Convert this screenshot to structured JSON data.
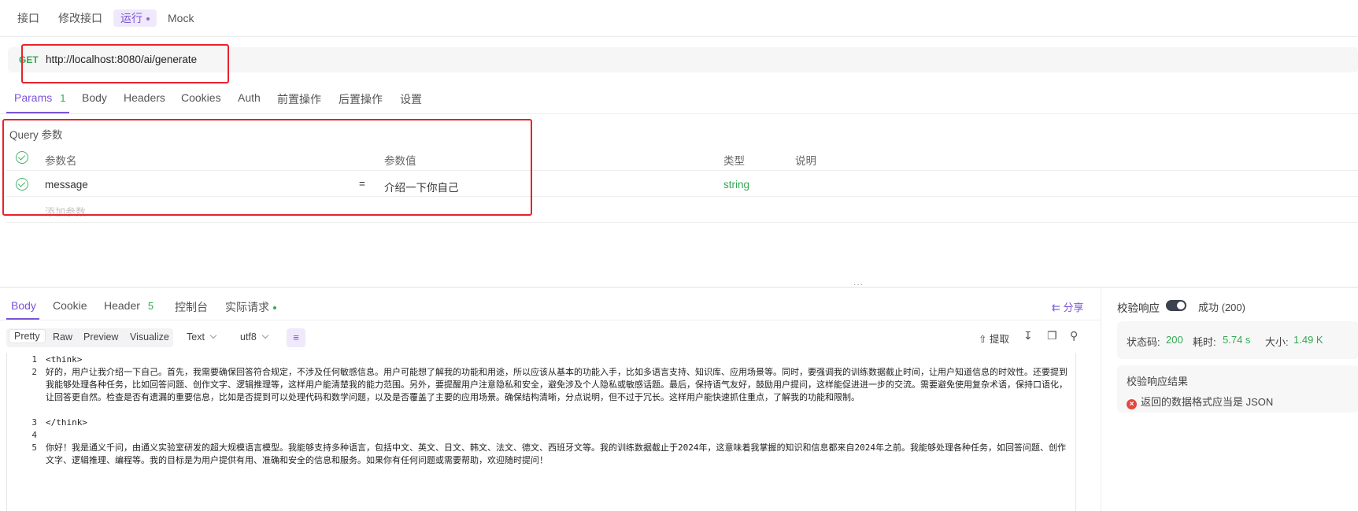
{
  "top_tabs": {
    "api": "接口",
    "edit": "修改接口",
    "run": "运行",
    "mock": "Mock"
  },
  "request": {
    "method": "GET",
    "url": "http://localhost:8080/ai/generate"
  },
  "request_tabs": {
    "params": "Params",
    "params_count": "1",
    "body": "Body",
    "headers": "Headers",
    "cookies": "Cookies",
    "auth": "Auth",
    "pre": "前置操作",
    "post": "后置操作",
    "settings": "设置"
  },
  "query": {
    "title": "Query 参数",
    "headers": {
      "name": "参数名",
      "value": "参数值",
      "type": "类型",
      "desc": "说明"
    },
    "rows": [
      {
        "name": "message",
        "eq": "=",
        "value": "介绍一下你自己",
        "type": "string"
      }
    ],
    "add_placeholder": "添加参数"
  },
  "response_tabs": {
    "body": "Body",
    "cookie": "Cookie",
    "header": "Header",
    "header_count": "5",
    "console": "控制台",
    "actual": "实际请求"
  },
  "share": "分享",
  "format_tabs": {
    "pretty": "Pretty",
    "raw": "Raw",
    "preview": "Preview",
    "visualize": "Visualize"
  },
  "content_type": "Text",
  "encoding": "utf8",
  "toolbar": {
    "extract": "提取"
  },
  "code_lines": [
    {
      "n": "1",
      "text": "<think>"
    },
    {
      "n": "2",
      "text": "好的，用户让我介绍一下自己。首先，我需要确保回答符合规定，不涉及任何敏感信息。用户可能想了解我的功能和用途，所以应该从基本的功能入手，比如多语言支持、知识库、应用场景等。同时，要强调我的训练数据截止时间，让用户知道信息的时效性。还要提到我能够处理各种任务，比如回答问题、创作文字、逻辑推理等，这样用户能清楚我的能力范围。另外，要提醒用户注意隐私和安全，避免涉及个人隐私或敏感话题。最后，保持语气友好，鼓励用户提问，这样能促进进一步的交流。需要避免使用复杂术语，保持口语化，让回答更自然。检查是否有遗漏的重要信息，比如是否提到可以处理代码和数学问题，以及是否覆盖了主要的应用场景。确保结构清晰，分点说明，但不过于冗长。这样用户能快速抓住重点，了解我的功能和限制。"
    },
    {
      "n": "3",
      "text": "</think>"
    },
    {
      "n": "4",
      "text": ""
    },
    {
      "n": "5",
      "text": "你好！我是通义千问，由通义实验室研发的超大规模语言模型。我能够支持多种语言，包括中文、英文、日文、韩文、法文、德文、西班牙文等。我的训练数据截止于2024年，这意味着我掌握的知识和信息都来自2024年之前。我能够处理各种任务，如回答问题、创作文字、逻辑推理、编程等。我的目标是为用户提供有用、准确和安全的信息和服务。如果你有任何问题或需要帮助，欢迎随时提问！"
    }
  ],
  "validation": {
    "label": "校验响应",
    "result": "成功 (200)",
    "status_label": "状态码:",
    "status_value": "200",
    "time_label": "耗时:",
    "time_value": "5.74 s",
    "size_label": "大小:",
    "size_value": "1.49 K",
    "result_title": "校验响应结果",
    "error_msg": "返回的数据格式应当是 JSON"
  },
  "colors": {
    "accent": "#7b55d6",
    "success": "#34a853",
    "highlight_box": "#e8222a",
    "error": "#e5483e"
  }
}
